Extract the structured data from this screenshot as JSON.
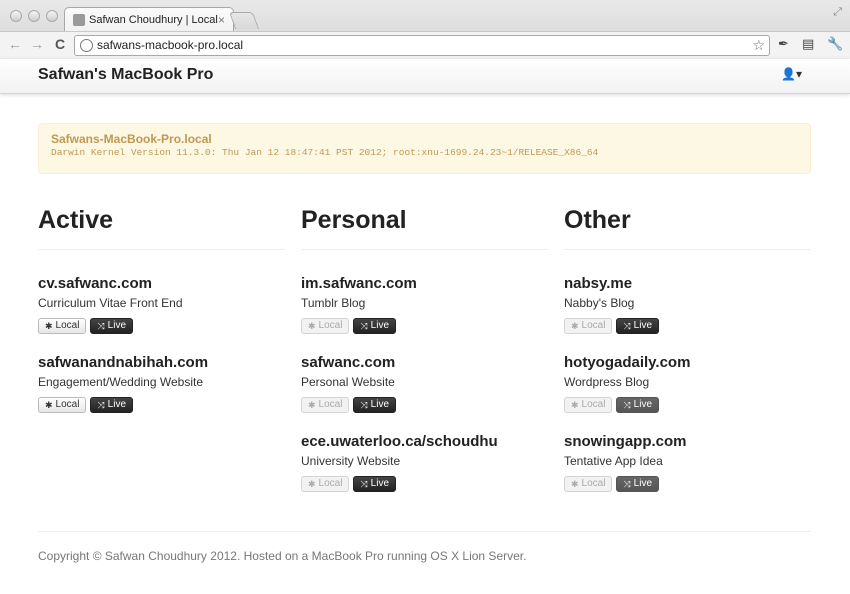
{
  "browser": {
    "tab_title": "Safwan Choudhury | Local",
    "tab_close": "×",
    "favicon": "",
    "url": "safwans-macbook-pro.local",
    "back_icon": "←",
    "forward_icon": "→",
    "reload_icon": "C",
    "star_icon": "☆",
    "ext_icons": [
      "✒",
      "▤",
      "🔧"
    ]
  },
  "navbar": {
    "brand": "Safwan's MacBook Pro",
    "user_icon": "👤▾"
  },
  "alert": {
    "hostname": "Safwans-MacBook-Pro.local",
    "kernel": "Darwin Kernel Version 11.3.0: Thu Jan 12 18:47:41 PST 2012; root:xnu-1699.24.23~1/RELEASE_X86_64"
  },
  "buttons": {
    "local_label": "Local",
    "live_label": "Live",
    "local_icon": "✱",
    "live_icon": "⤨"
  },
  "columns": [
    {
      "heading": "Active",
      "sites": [
        {
          "name": "cv.safwanc.com",
          "desc": "Curriculum Vitae Front End"
        },
        {
          "name": "safwanandnabihah.com",
          "desc": "Engagement/Wedding Website"
        }
      ]
    },
    {
      "heading": "Personal",
      "sites": [
        {
          "name": "im.safwanc.com",
          "desc": "Tumblr Blog"
        },
        {
          "name": "safwanc.com",
          "desc": "Personal Website"
        },
        {
          "name": "ece.uwaterloo.ca/schoudhu",
          "desc": "University Website"
        }
      ]
    },
    {
      "heading": "Other",
      "sites": [
        {
          "name": "nabsy.me",
          "desc": "Nabby's Blog"
        },
        {
          "name": "hotyogadaily.com",
          "desc": "Wordpress Blog"
        },
        {
          "name": "snowingapp.com",
          "desc": "Tentative App Idea"
        }
      ]
    }
  ],
  "footer": {
    "text": "Copyright © Safwan Choudhury 2012. Hosted on a MacBook Pro running OS X Lion Server."
  }
}
